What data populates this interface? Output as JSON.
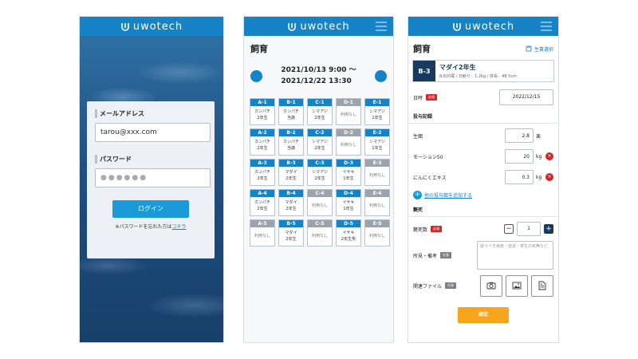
{
  "app": {
    "logo_text": "uwotech"
  },
  "login": {
    "email_label": "メールアドレス",
    "email_value": "tarou@xxx.com",
    "password_label": "パスワード",
    "password_value": "●●●●●●",
    "login_button": "ログイン",
    "forgot_text": "※パスワードを忘れた方は",
    "forgot_link": "コチラ"
  },
  "pens": {
    "title": "飼育",
    "date_start": "2021/10/13 9:00 〜",
    "date_end": "2021/12/22 13:30",
    "cells": [
      {
        "code": "A-1",
        "l1": "カンパチ",
        "l2": "2年生",
        "off": false
      },
      {
        "code": "B-1",
        "l1": "カンパチ",
        "l2": "当歳",
        "off": false
      },
      {
        "code": "C-1",
        "l1": "シマアジ",
        "l2": "2年生",
        "off": false
      },
      {
        "code": "D-1",
        "l1": "利用なし",
        "l2": "",
        "off": true
      },
      {
        "code": "E-1",
        "l1": "シマアジ",
        "l2": "1年生",
        "off": false
      },
      {
        "code": "A-2",
        "l1": "カンパチ",
        "l2": "2年生",
        "off": false
      },
      {
        "code": "B-2",
        "l1": "カンパチ",
        "l2": "当歳",
        "off": false
      },
      {
        "code": "C-2",
        "l1": "シマアジ",
        "l2": "2年生",
        "off": false
      },
      {
        "code": "D-2",
        "l1": "利用なし",
        "l2": "",
        "off": true
      },
      {
        "code": "E-2",
        "l1": "シマアジ",
        "l2": "1年生",
        "off": false
      },
      {
        "code": "A-3",
        "l1": "カンパチ",
        "l2": "2年生",
        "off": false
      },
      {
        "code": "B-3",
        "l1": "マダイ",
        "l2": "2年生",
        "off": false
      },
      {
        "code": "C-3",
        "l1": "シマアジ",
        "l2": "2年生",
        "off": false
      },
      {
        "code": "D-3",
        "l1": "イサキ",
        "l2": "1年生",
        "off": false
      },
      {
        "code": "E-3",
        "l1": "利用なし",
        "l2": "",
        "off": true
      },
      {
        "code": "A-4",
        "l1": "カンパチ",
        "l2": "2年生",
        "off": false
      },
      {
        "code": "B-4",
        "l1": "マダイ",
        "l2": "2年生",
        "off": false
      },
      {
        "code": "C-4",
        "l1": "利用なし",
        "l2": "",
        "off": true
      },
      {
        "code": "D-4",
        "l1": "イサキ",
        "l2": "1年生",
        "off": false
      },
      {
        "code": "E-4",
        "l1": "利用なし",
        "l2": "",
        "off": true
      },
      {
        "code": "A-5",
        "l1": "利用なし",
        "l2": "",
        "off": true
      },
      {
        "code": "B-5",
        "l1": "マダイ",
        "l2": "2年生",
        "off": false
      },
      {
        "code": "C-5",
        "l1": "利用なし",
        "l2": "",
        "off": true
      },
      {
        "code": "D-5",
        "l1": "イサキ",
        "l2": "2年生魚",
        "off": false
      },
      {
        "code": "E-5",
        "l1": "利用なし",
        "l2": "",
        "off": true
      }
    ]
  },
  "record": {
    "title": "飼育",
    "site_select": "生簀選択",
    "pen_id": "B-3",
    "pen_name": "マダイ2年生",
    "pen_sub": "8,820尾 / 日齢り：1.2kg / 体長：48.5cm",
    "date_label": "日時",
    "required": "必須",
    "optional": "任意",
    "date_value": "2022/12/15",
    "feed_section": "投与記録",
    "feeds": [
      {
        "name": "生餌",
        "value": "2.8",
        "unit": "楽",
        "removable": false
      },
      {
        "name": "モーション50",
        "value": "20",
        "unit": "kg",
        "removable": true
      },
      {
        "name": "にんにくエキス",
        "value": "0.3",
        "unit": "kg",
        "removable": true
      }
    ],
    "add_feed": "他の投与餌を追加する",
    "death_section": "斃死",
    "death_count_label": "斃死数",
    "death_count": "1",
    "notes_label": "所見・備考",
    "notes_placeholder": "疑うべき病気・症状・寄生の有無など",
    "files_label": "関連ファイル",
    "confirm_button": "確定"
  },
  "colors": {
    "brand": "#1683c7",
    "navy": "#183a5e",
    "danger": "#d42828",
    "accent": "#f7a51c"
  }
}
